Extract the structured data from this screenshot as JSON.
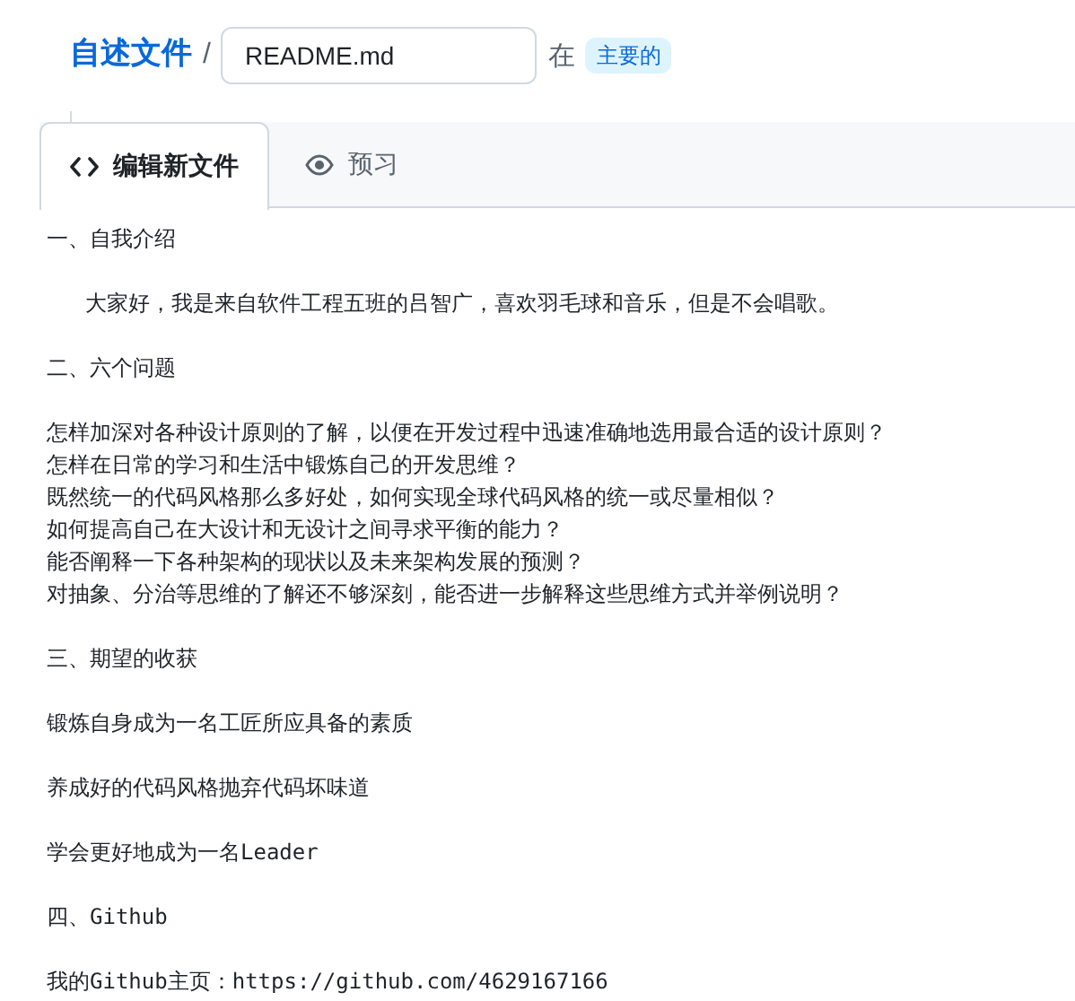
{
  "breadcrumb": {
    "repo": "自述文件",
    "separator": "/",
    "filename": "README.md",
    "in_label": "在",
    "branch": "主要的"
  },
  "tabs": [
    {
      "label": "编辑新文件",
      "kind": "code",
      "selected": true
    },
    {
      "label": "预习",
      "kind": "eye",
      "selected": false
    }
  ],
  "editor": {
    "paragraphs": [
      [
        "一、自我介绍"
      ],
      [
        "   大家好，我是来自软件工程五班的吕智广，喜欢羽毛球和音乐，但是不会唱歌。"
      ],
      [
        "二、六个问题"
      ],
      [
        "怎样加深对各种设计原则的了解，以便在开发过程中迅速准确地选用最合适的设计原则？",
        "怎样在日常的学习和生活中锻炼自己的开发思维？",
        "既然统一的代码风格那么多好处，如何实现全球代码风格的统一或尽量相似？",
        "如何提高自己在大设计和无设计之间寻求平衡的能力？",
        "能否阐释一下各种架构的现状以及未来架构发展的预测？",
        "对抽象、分治等思维的了解还不够深刻，能否进一步解释这些思维方式并举例说明？"
      ],
      [
        "三、期望的收获"
      ],
      [
        "锻炼自身成为一名工匠所应具备的素质"
      ],
      [
        "养成好的代码风格抛弃代码坏味道"
      ],
      [
        "学会更好地成为一名Leader"
      ],
      [
        "四、Github"
      ],
      [
        "我的Github主页：https://github.com/4629167166"
      ]
    ]
  }
}
